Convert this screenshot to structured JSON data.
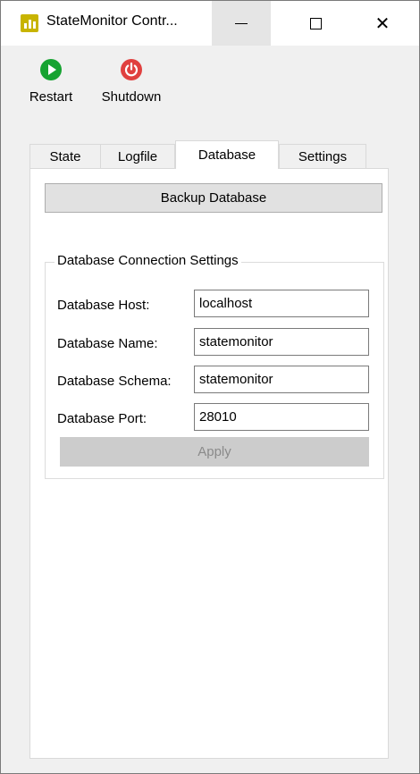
{
  "window": {
    "title": "StateMonitor Contr...",
    "minimize_icon": "minimize-icon",
    "maximize_icon": "maximize-icon",
    "close_icon": "close-icon",
    "close_glyph": "✕"
  },
  "toolbar": {
    "restart_label": "Restart",
    "restart_icon": "play-icon",
    "shutdown_label": "Shutdown",
    "shutdown_icon": "power-icon",
    "restart_color": "#16a331",
    "shutdown_color": "#e0403f"
  },
  "tabs": [
    {
      "label": "State",
      "active": false
    },
    {
      "label": "Logfile",
      "active": false
    },
    {
      "label": "Database",
      "active": true
    },
    {
      "label": "Settings",
      "active": false
    }
  ],
  "database": {
    "backup_button": "Backup Database",
    "group_title": "Database Connection Settings",
    "fields": [
      {
        "label": "Database Host:",
        "value": "localhost"
      },
      {
        "label": "Database Name:",
        "value": "statemonitor"
      },
      {
        "label": "Database Schema:",
        "value": "statemonitor"
      },
      {
        "label": "Database Port:",
        "value": "28010"
      }
    ],
    "apply_button": "Apply",
    "apply_enabled": false
  }
}
